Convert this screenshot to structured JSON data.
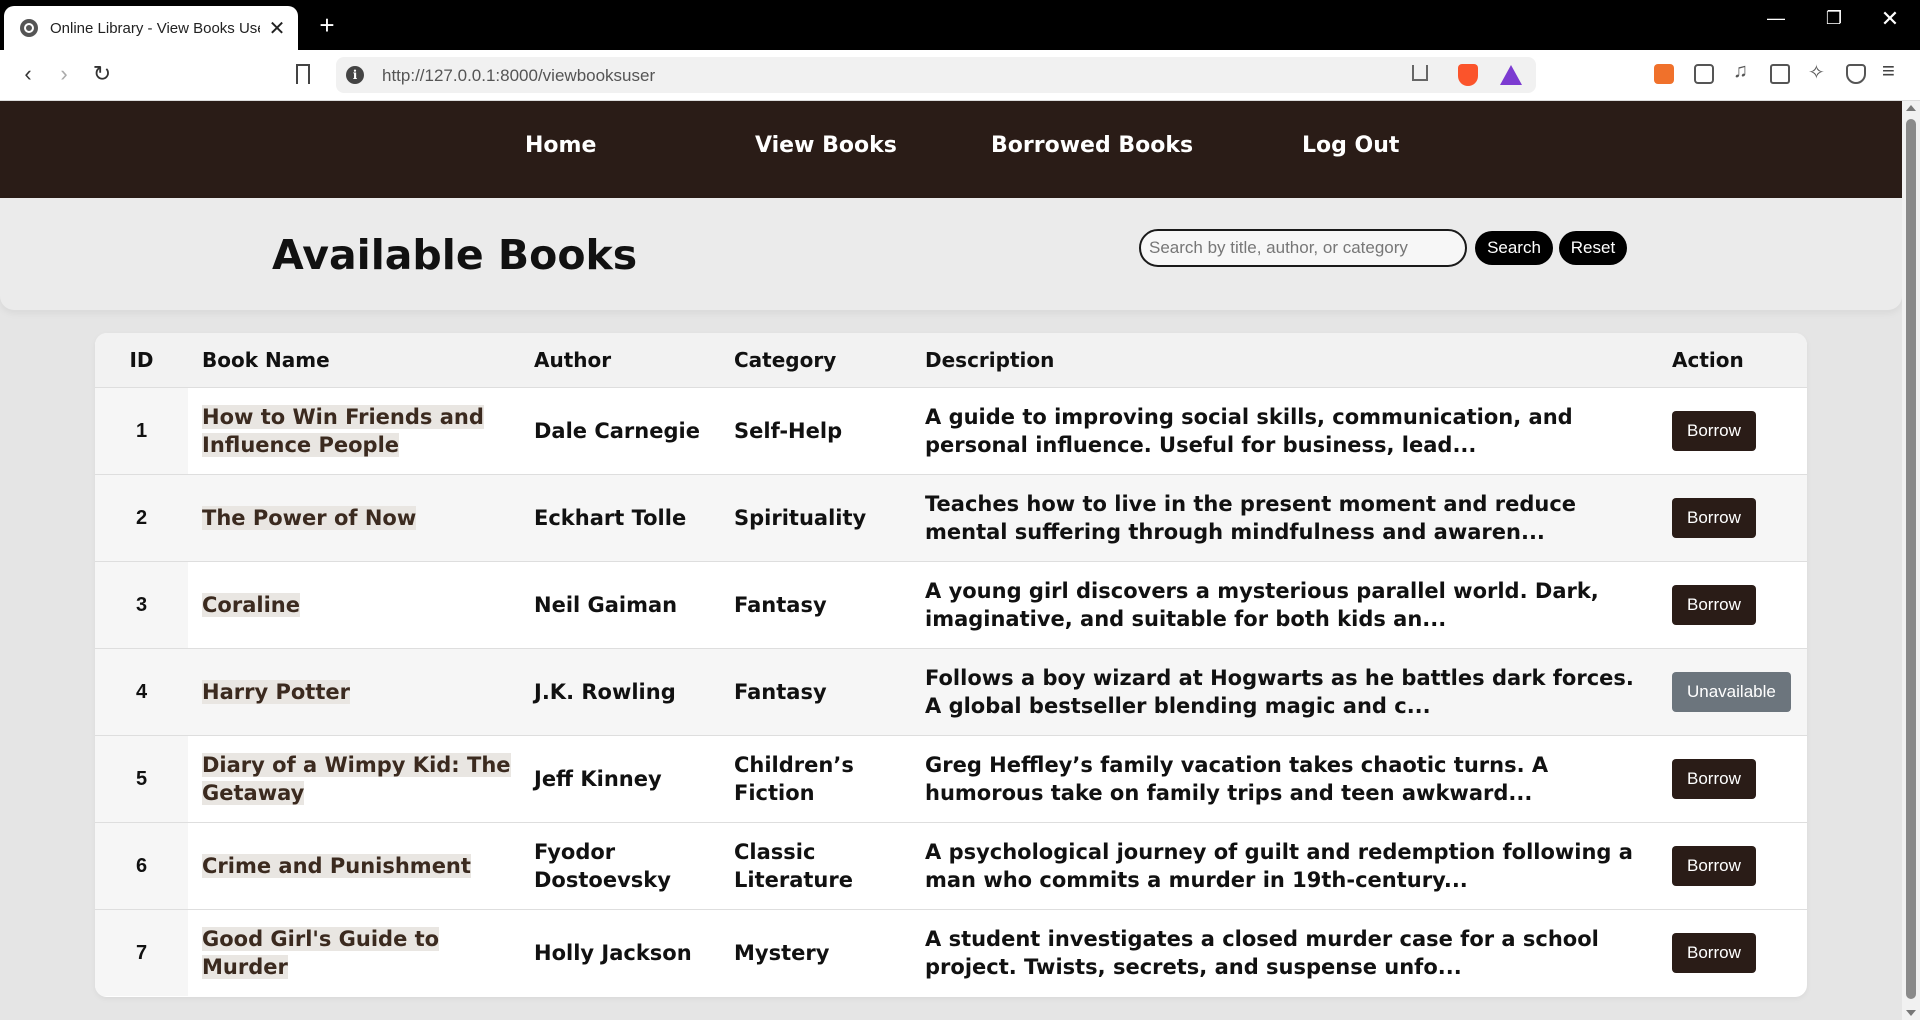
{
  "browser": {
    "tab_title": "Online Library - View Books User",
    "tab_close": "✕",
    "new_tab": "+",
    "url": "http://127.0.0.1:8000/viewbooksuser",
    "window_controls": {
      "minimize": "—",
      "restore": "❐",
      "close": "✕"
    },
    "icons": [
      "globe-icon",
      "back-icon",
      "forward-icon",
      "reload-icon",
      "bookmark-icon",
      "info-icon",
      "share-icon",
      "brave-shields-icon",
      "brave-rewards-icon",
      "extension-icon",
      "puzzle-icon",
      "music-icon",
      "sidebar-icon",
      "leo-icon",
      "vpn-icon",
      "menu-icon"
    ]
  },
  "nav": {
    "items": [
      {
        "label": "Home"
      },
      {
        "label": "View Books"
      },
      {
        "label": "Borrowed Books"
      },
      {
        "label": "Log Out"
      }
    ],
    "bg_color": "#2a1c17"
  },
  "header": {
    "title": "Available Books",
    "search_placeholder": "Search by title, author, or category",
    "search_value": "",
    "search_button": "Search",
    "reset_button": "Reset"
  },
  "table": {
    "columns": [
      "ID",
      "Book Name",
      "Author",
      "Category",
      "Description",
      "Action"
    ],
    "rows": [
      {
        "id": "1",
        "name": "How to Win Friends and Influence People",
        "author": "Dale Carnegie",
        "category": "Self-Help",
        "description": "A guide to improving social skills, communication, and personal influence. Useful for business, lead...",
        "action": "Borrow",
        "available": true
      },
      {
        "id": "2",
        "name": "The Power of Now",
        "author": "Eckhart Tolle",
        "category": "Spirituality",
        "description": "Teaches how to live in the present moment and reduce mental suffering through mindfulness and awaren...",
        "action": "Borrow",
        "available": true
      },
      {
        "id": "3",
        "name": "Coraline",
        "author": "Neil Gaiman",
        "category": "Fantasy",
        "description": "A young girl discovers a mysterious parallel world. Dark, imaginative, and suitable for both kids an...",
        "action": "Borrow",
        "available": true
      },
      {
        "id": "4",
        "name": "Harry Potter",
        "author": "J.K. Rowling",
        "category": "Fantasy",
        "description": "Follows a boy wizard at Hogwarts as he battles dark forces. A global bestseller blending magic and c...",
        "action": "Unavailable",
        "available": false
      },
      {
        "id": "5",
        "name": "Diary of a Wimpy Kid: The Getaway",
        "author": "Jeff Kinney",
        "category": "Children’s Fiction",
        "description": "Greg Heffley’s family vacation takes chaotic turns. A humorous take on family trips and teen awkward...",
        "action": "Borrow",
        "available": true
      },
      {
        "id": "6",
        "name": "Crime and Punishment",
        "author": "Fyodor Dostoevsky",
        "category": "Classic Literature",
        "description": "A psychological journey of guilt and redemption following a man who commits a murder in 19th-century...",
        "action": "Borrow",
        "available": true
      },
      {
        "id": "7",
        "name": "Good Girl's Guide to Murder",
        "author": "Holly Jackson",
        "category": "Mystery",
        "description": "A student investigates a closed murder case for a school project. Twists, secrets, and suspense unfo...",
        "action": "Borrow",
        "available": true
      }
    ],
    "colors": {
      "borrow": "#2a1c17",
      "unavailable": "#6c757d"
    }
  }
}
